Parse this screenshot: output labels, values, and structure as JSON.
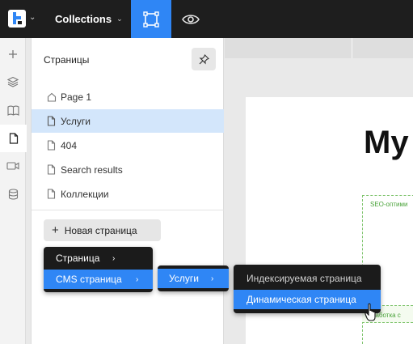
{
  "topbar": {
    "logo_icon": "webflow-logo-icon",
    "collections_label": "Collections",
    "select_tool_icon": "select-frame-icon",
    "preview_icon": "eye-icon",
    "accent": "#2f86f5"
  },
  "rail": {
    "items": [
      "plus-icon",
      "layers-icon",
      "book-icon",
      "page-icon",
      "video-icon",
      "database-icon"
    ],
    "active": "page-icon"
  },
  "pages_panel": {
    "title": "Страницы",
    "pin_icon": "pin-icon",
    "pages": [
      {
        "label": "Page 1",
        "icon": "home-icon"
      },
      {
        "label": "Услуги",
        "icon": "page-icon",
        "selected": true
      },
      {
        "label": "404",
        "icon": "page-icon"
      },
      {
        "label": "Search results",
        "icon": "page-icon"
      },
      {
        "label": "Коллекции",
        "icon": "page-icon"
      }
    ],
    "new_page_label": "Новая страница"
  },
  "canvas": {
    "heading": "My",
    "seo_label": "SEO-оптими",
    "dev_label": "азработка с"
  },
  "menus": {
    "level1": [
      {
        "label": "Страница",
        "has_submenu": true
      },
      {
        "label": "CMS страница",
        "has_submenu": true,
        "highlighted": true
      }
    ],
    "level2": [
      {
        "label": "Услуги",
        "has_submenu": true,
        "highlighted": true
      }
    ],
    "level3": [
      {
        "label": "Индексируемая страница"
      },
      {
        "label": "Динамическая страница",
        "highlighted": true
      }
    ],
    "arrow_glyph": "›"
  }
}
